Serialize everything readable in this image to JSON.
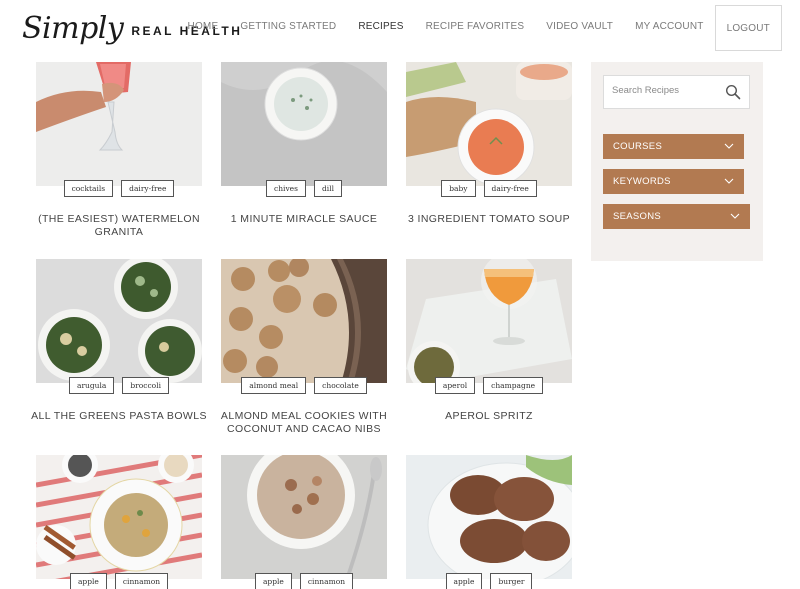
{
  "brand": {
    "script": "Simply",
    "word": "REAL HEALTH"
  },
  "nav": [
    {
      "label": "HOME"
    },
    {
      "label": "GETTING STARTED"
    },
    {
      "label": "RECIPES"
    },
    {
      "label": "RECIPE FAVORITES"
    },
    {
      "label": "VIDEO VAULT"
    },
    {
      "label": "MY ACCOUNT"
    },
    {
      "label": "LOGOUT"
    }
  ],
  "recipes": [
    {
      "title": "(THE EASIEST) WATERMELON GRANITA",
      "tags": [
        "cocktails",
        "dairy-free"
      ]
    },
    {
      "title": "1 MINUTE MIRACLE SAUCE",
      "tags": [
        "chives",
        "dill"
      ]
    },
    {
      "title": "3 INGREDIENT TOMATO SOUP",
      "tags": [
        "baby",
        "dairy-free"
      ]
    },
    {
      "title": "ALL THE GREENS PASTA BOWLS",
      "tags": [
        "arugula",
        "broccoli"
      ]
    },
    {
      "title": "ALMOND MEAL COOKIES WITH COCONUT AND CACAO NIBS",
      "tags": [
        "almond meal",
        "chocolate"
      ]
    },
    {
      "title": "APEROL SPRITZ",
      "tags": [
        "aperol",
        "champagne"
      ]
    },
    {
      "title": "",
      "tags": [
        "apple",
        "cinnamon"
      ]
    },
    {
      "title": "",
      "tags": [
        "apple",
        "cinnamon"
      ]
    },
    {
      "title": "",
      "tags": [
        "apple",
        "burger"
      ]
    }
  ],
  "sidebar": {
    "search_placeholder": "Search Recipes",
    "filters": [
      {
        "label": "COURSES"
      },
      {
        "label": "KEYWORDS"
      },
      {
        "label": "SEASONS"
      }
    ]
  },
  "colors": {
    "accent": "#b27a51",
    "sidebar_bg": "#f3f0ee"
  },
  "icons": {
    "search": "search-icon",
    "chevron": "chevron-down-icon"
  }
}
